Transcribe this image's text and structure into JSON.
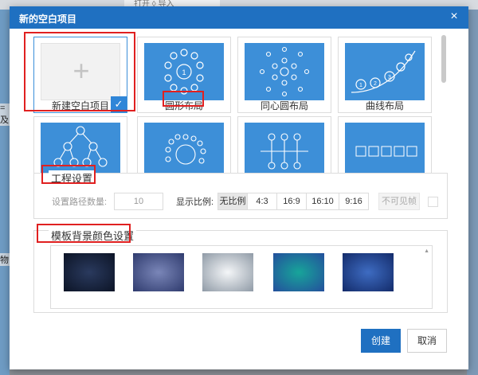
{
  "background": {
    "tab_text": "打开 ◊ 导入",
    "left_text_1": "=及",
    "left_text_2": "物"
  },
  "dialog": {
    "title": "新的空白项目",
    "close_label": "×"
  },
  "templates": [
    {
      "label": "新建空白项目",
      "icon": "plus-icon",
      "selected": true
    },
    {
      "label": "圆形布局",
      "icon": "circle-layout"
    },
    {
      "label": "同心圆布局",
      "icon": "concentric-layout"
    },
    {
      "label": "曲线布局",
      "icon": "curve-layout"
    },
    {
      "label": "",
      "icon": "tree-layout"
    },
    {
      "label": "",
      "icon": "spiral-layout"
    },
    {
      "label": "",
      "icon": "timeline-layout"
    },
    {
      "label": "",
      "icon": "bracket-layout"
    }
  ],
  "project_settings": {
    "title": "工程设置",
    "path_count_label": "设置路径数量:",
    "path_count_value": "10",
    "ratio_label": "显示比例:",
    "ratios": [
      "无比例",
      "4:3",
      "16:9",
      "16:10",
      "9:16"
    ],
    "active_ratio": "无比例",
    "invisible_frame_label": "不可见帧"
  },
  "background_settings": {
    "title": "模板背景颜色设置",
    "swatches": [
      {
        "name": "dark-navy",
        "from": "#2a3a5e",
        "to": "#0c1426"
      },
      {
        "name": "slate-blue",
        "from": "#7a86b8",
        "to": "#2f3b6e"
      },
      {
        "name": "silver-gray",
        "from": "#f4f6f8",
        "to": "#8f9aa6"
      },
      {
        "name": "teal-blue",
        "from": "#17a59a",
        "to": "#244f9c"
      },
      {
        "name": "royal-blue",
        "from": "#3e6cc2",
        "to": "#132b6a"
      }
    ]
  },
  "buttons": {
    "create": "创建",
    "cancel": "取消"
  },
  "colors": {
    "accent": "#1f70c1",
    "highlight": "#e02020",
    "thumb": "#3d8fd8"
  }
}
